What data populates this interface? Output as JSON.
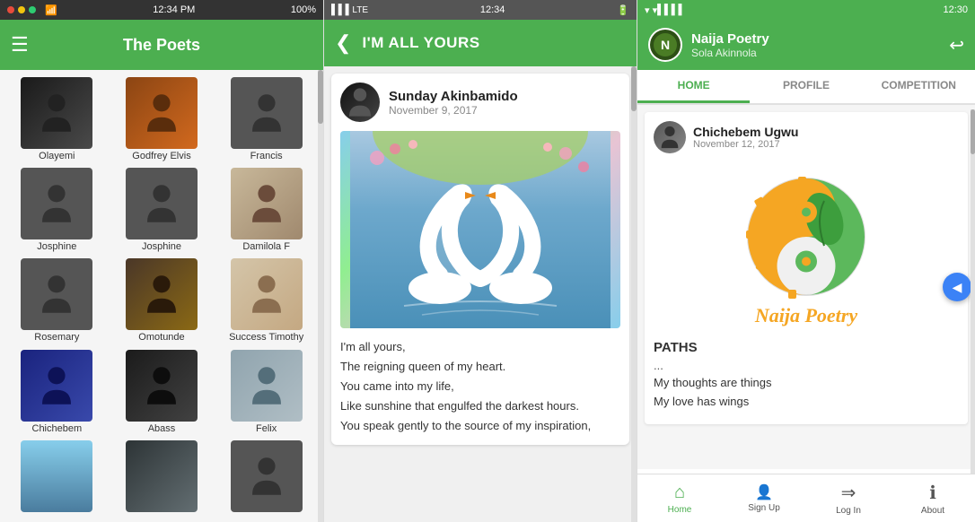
{
  "panel1": {
    "statusbar": {
      "time": "12:34 PM",
      "battery": "100%",
      "wifi": "wifi"
    },
    "title": "The Poets",
    "hamburger_label": "☰",
    "poets": [
      {
        "name": "Olayemi",
        "type": "photo",
        "photo_class": "photo-olayemi"
      },
      {
        "name": "Godfrey Elvis",
        "type": "photo",
        "photo_class": "photo-godfrey"
      },
      {
        "name": "Francis",
        "type": "silhouette"
      },
      {
        "name": "Josphine",
        "type": "silhouette"
      },
      {
        "name": "Josphine",
        "type": "silhouette"
      },
      {
        "name": "Damilola F",
        "type": "photo",
        "photo_class": "photo-damilola"
      },
      {
        "name": "Rosemary",
        "type": "silhouette"
      },
      {
        "name": "Omotunde",
        "type": "photo",
        "photo_class": "photo-omotunde"
      },
      {
        "name": "Success Timothy",
        "type": "photo",
        "photo_class": "photo-success"
      },
      {
        "name": "Chichebem",
        "type": "photo",
        "photo_class": "photo-chichebem"
      },
      {
        "name": "Abass",
        "type": "photo",
        "photo_class": "photo-abass"
      },
      {
        "name": "Felix",
        "type": "photo",
        "photo_class": "photo-felix"
      },
      {
        "name": "",
        "type": "photo",
        "photo_class": "photo-dark1"
      },
      {
        "name": "",
        "type": "photo",
        "photo_class": "photo-dark2"
      },
      {
        "name": "",
        "type": "silhouette"
      }
    ]
  },
  "panel2": {
    "statusbar": {
      "time": "12:34"
    },
    "title": "I'M ALL YOURS",
    "poem": {
      "author": "Sunday Akinbamido",
      "date": "November 9, 2017",
      "lines": [
        "I'm all yours,",
        "The reigning queen of my heart.",
        "You came into my life,",
        "Like sunshine that engulfed the darkest hours.",
        "You speak gently to the source of my inspiration,"
      ]
    }
  },
  "panel3": {
    "statusbar": {
      "time": "12:30"
    },
    "app_name": "Naija Poetry",
    "user_name": "Sola Akinnola",
    "tabs": [
      {
        "label": "HOME",
        "active": true
      },
      {
        "label": "PROFILE",
        "active": false
      },
      {
        "label": "COMPETITION",
        "active": false
      }
    ],
    "post": {
      "author": "Chichebem Ugwu",
      "date": "November 12, 2017"
    },
    "logo_text": "Naija Poetry",
    "paths_title": "PATHS",
    "paths_dots": "...",
    "paths_lines": [
      "My thoughts are things",
      "My love has wings"
    ],
    "bottom_nav": [
      {
        "label": "Home",
        "icon": "⌂",
        "active": true
      },
      {
        "label": "Sign Up",
        "icon": "👤+",
        "active": false
      },
      {
        "label": "Log In",
        "icon": "→",
        "active": false
      },
      {
        "label": "About",
        "icon": "ℹ",
        "active": false
      }
    ]
  }
}
